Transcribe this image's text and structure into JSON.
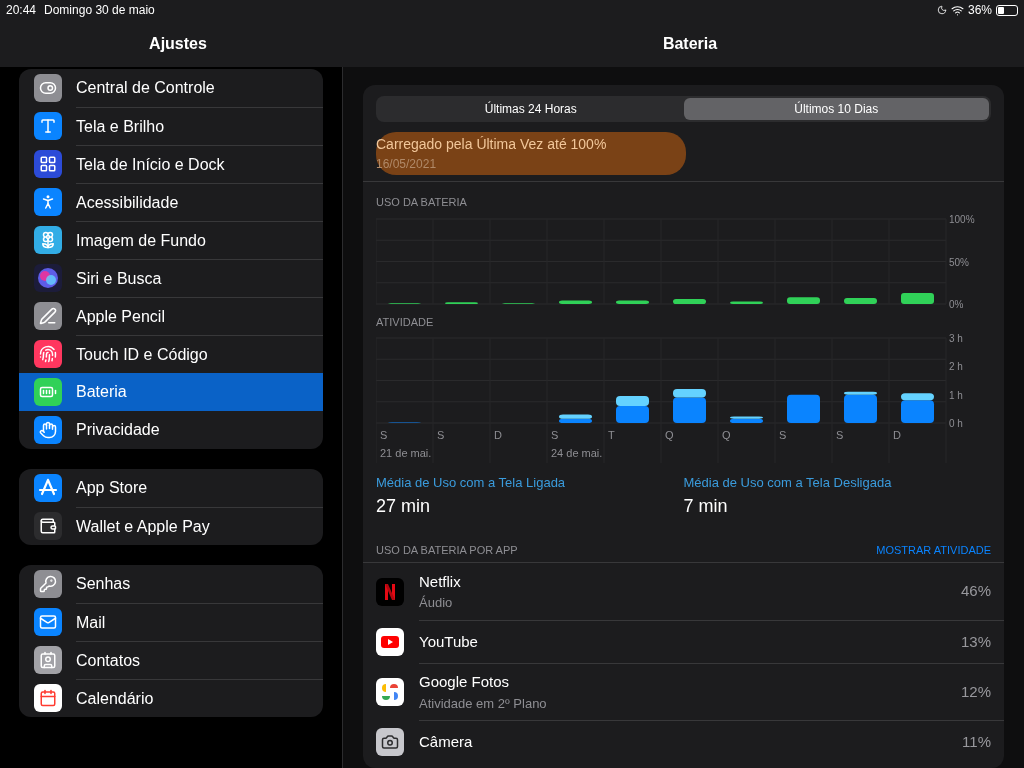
{
  "status_bar": {
    "time": "20:44",
    "date": "Domingo 30 de maio",
    "battery_text": "36%",
    "level": 0.36
  },
  "sidebar": {
    "title": "Ajustes",
    "groups": [
      {
        "items": [
          {
            "label": "Central de Controle",
            "kind": "control",
            "selected": false
          },
          {
            "label": "Tela e Brilho",
            "kind": "display",
            "selected": false
          },
          {
            "label": "Tela de Início e Dock",
            "kind": "home",
            "selected": false
          },
          {
            "label": "Acessibilidade",
            "kind": "accessibility",
            "selected": false
          },
          {
            "label": "Imagem de Fundo",
            "kind": "wallpaper",
            "selected": false
          },
          {
            "label": "Siri e Busca",
            "kind": "siri",
            "selected": false
          },
          {
            "label": "Apple Pencil",
            "kind": "pencil",
            "selected": false
          },
          {
            "label": "Touch ID e Código",
            "kind": "touchid",
            "selected": false
          },
          {
            "label": "Bateria",
            "kind": "battery",
            "selected": true
          },
          {
            "label": "Privacidade",
            "kind": "privacy",
            "selected": false
          }
        ]
      },
      {
        "items": [
          {
            "label": "App Store",
            "kind": "appstore",
            "selected": false
          },
          {
            "label": "Wallet e Apple Pay",
            "kind": "wallet",
            "selected": false
          }
        ]
      },
      {
        "items": [
          {
            "label": "Senhas",
            "kind": "passwords",
            "selected": false
          },
          {
            "label": "Mail",
            "kind": "mail",
            "selected": false
          },
          {
            "label": "Contatos",
            "kind": "contacts",
            "selected": false
          },
          {
            "label": "Calendário",
            "kind": "calendar",
            "selected": false
          }
        ]
      }
    ]
  },
  "detail": {
    "title": "Bateria",
    "tabs": [
      {
        "label": "Últimas 24 Horas",
        "selected": false
      },
      {
        "label": "Últimos 10 Dias",
        "selected": true
      }
    ],
    "last_charge": {
      "title": "Carregado pela Última Vez até 100%",
      "date": "16/05/2021",
      "highlighted": true
    },
    "battery_chart": {
      "label": "USO DA BATERIA",
      "chart_data": {
        "type": "bar",
        "values": [
          1,
          2,
          1,
          4,
          4,
          6,
          3,
          8,
          7,
          13
        ],
        "ylim": [
          0,
          100
        ],
        "yticks": [
          {
            "value": 0,
            "label": "0%"
          },
          {
            "value": 50,
            "label": "50%"
          },
          {
            "value": 100,
            "label": "100%"
          }
        ]
      }
    },
    "activity_chart": {
      "label": "ATIVIDADE",
      "chart_data": {
        "type": "bar",
        "stacked": true,
        "categories": [
          "S",
          "S",
          "D",
          "S",
          "T",
          "Q",
          "Q",
          "S",
          "S",
          "D"
        ],
        "series": [
          {
            "color": "#0a84ff",
            "values": [
              0.02,
              0,
              0,
              0.15,
              0.6,
              0.9,
              0.15,
              1.0,
              1.0,
              0.8
            ]
          },
          {
            "color": "#64d2ff",
            "values": [
              0,
              0,
              0,
              0.15,
              0.35,
              0.3,
              0.08,
              0,
              0.1,
              0.25
            ]
          }
        ],
        "ylim": [
          0,
          3
        ],
        "yticks": [
          {
            "value": 0,
            "label": "0 h"
          },
          {
            "value": 1,
            "label": "1 h"
          },
          {
            "value": 2,
            "label": "2 h"
          },
          {
            "value": 3,
            "label": "3 h"
          }
        ],
        "annotations": [
          "21 de mai.",
          "24 de mai."
        ]
      }
    },
    "averages": [
      {
        "label": "Média de Uso com a Tela Ligada",
        "value": "27 min"
      },
      {
        "label": "Média de Uso com a Tela Desligada",
        "value": "7 min"
      }
    ],
    "apps_header": "USO DA BATERIA POR APP",
    "show_activity": "MOSTRAR ATIVIDADE",
    "apps": [
      {
        "name": "Netflix",
        "detail": "Áudio",
        "percent": "46%",
        "kind": "netflix"
      },
      {
        "name": "YouTube",
        "percent": "13%",
        "kind": "youtube"
      },
      {
        "name": "Google Fotos",
        "detail": "Atividade em 2º Plano",
        "percent": "12%",
        "kind": "photos"
      },
      {
        "name": "Câmera",
        "percent": "11%",
        "kind": "camera"
      }
    ]
  }
}
